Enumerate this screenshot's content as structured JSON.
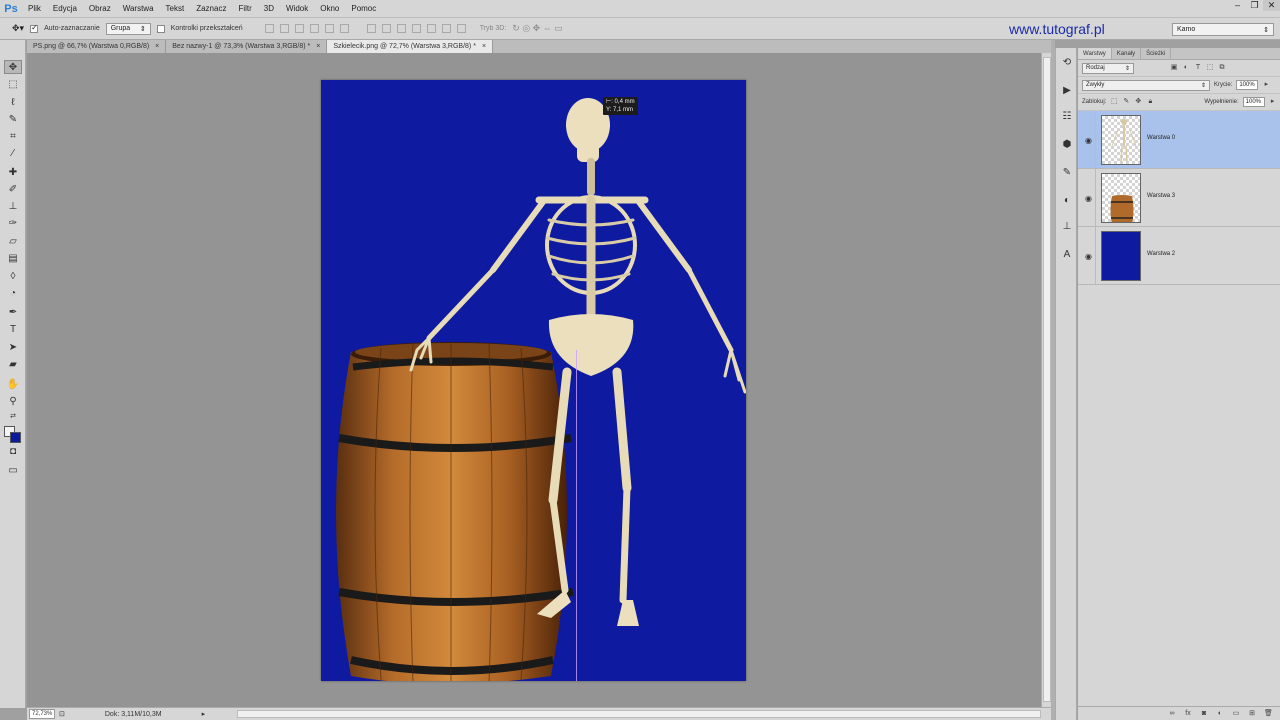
{
  "app": {
    "logo": "Ps"
  },
  "menu": [
    "Plik",
    "Edycja",
    "Obraz",
    "Warstwa",
    "Tekst",
    "Zaznacz",
    "Filtr",
    "3D",
    "Widok",
    "Okno",
    "Pomoc"
  ],
  "options": {
    "auto_select_label": "Auto-zaznaczanie",
    "auto_select_checked": true,
    "auto_select_mode": "Grupa",
    "transform_controls_label": "Kontrolki przekształceń",
    "transform_controls_checked": false,
    "mode_3d_label": "Tryb 3D:"
  },
  "watermark_url": "www.tutograf.pl",
  "workspace": "Kamo",
  "documents": [
    {
      "title": "PS.png @ 66,7% (Warstwa 0,RGB/8)",
      "active": false
    },
    {
      "title": "Bez nazwy-1 @ 73,3% (Warstwa 3,RGB/8) *",
      "active": false
    },
    {
      "title": "Szkielecik.png @ 72,7% (Warstwa 3,RGB/8) *",
      "active": true
    }
  ],
  "measure_tooltip": {
    "line1": "⊢: 0,4 mm",
    "line2": "Y: 7,1 mm"
  },
  "status": {
    "zoom": "72,73%",
    "doc": "Dok: 3,11M/10,3M"
  },
  "layers_panel": {
    "tabs": [
      "Warstwy",
      "Kanały",
      "Ścieżki"
    ],
    "filter": "Rodzaj",
    "blend_mode": "Zwykły",
    "opacity_label": "Krycie:",
    "opacity": "100%",
    "lock_label": "Zablokuj:",
    "fill_label": "Wypełnienie:",
    "fill": "100%",
    "layers": [
      {
        "name": "Warstwa 0",
        "thumb": "skeleton",
        "selected": true
      },
      {
        "name": "Warstwa 3",
        "thumb": "barrel",
        "selected": false
      },
      {
        "name": "Warstwa 2",
        "thumb": "blue",
        "selected": false
      }
    ]
  },
  "colors": {
    "document_bg": "#0e1aa0",
    "selection": "#a9c2ec",
    "url": "#1a2aa8"
  }
}
